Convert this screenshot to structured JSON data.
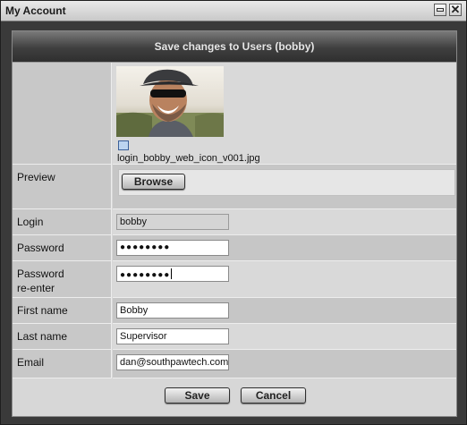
{
  "window": {
    "title": "My Account"
  },
  "header": {
    "title": "Save changes to Users (bobby)"
  },
  "photo": {
    "filename": "login_bobby_web_icon_v001.jpg"
  },
  "preview": {
    "label": "Preview",
    "browse_label": "Browse"
  },
  "fields": {
    "login": {
      "label": "Login",
      "value": "bobby"
    },
    "password": {
      "label": "Password",
      "value": "●●●●●●●●"
    },
    "password_reenter": {
      "label_line1": "Password",
      "label_line2": "re-enter",
      "value": "●●●●●●●●"
    },
    "first_name": {
      "label": "First name",
      "value": "Bobby"
    },
    "last_name": {
      "label": "Last name",
      "value": "Supervisor"
    },
    "email": {
      "label": "Email",
      "value": "dan@southpawtech.com"
    }
  },
  "footer": {
    "save_label": "Save",
    "cancel_label": "Cancel"
  }
}
